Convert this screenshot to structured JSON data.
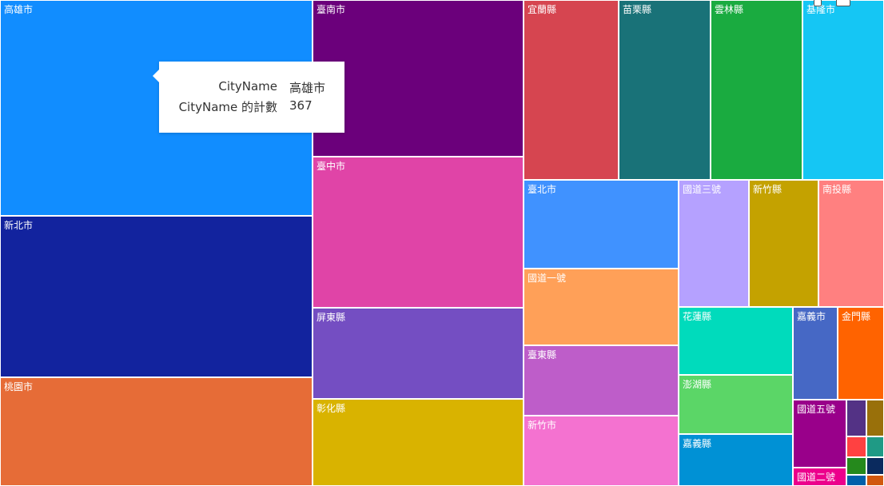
{
  "chart_data": {
    "type": "treemap",
    "series": [
      {
        "name": "高雄市",
        "color": "#118DFF"
      },
      {
        "name": "新北市",
        "color": "#12239E"
      },
      {
        "name": "桃園市",
        "color": "#E66C37"
      },
      {
        "name": "臺南市",
        "color": "#6B007B"
      },
      {
        "name": "臺中市",
        "color": "#E044A7"
      },
      {
        "name": "屏東縣",
        "color": "#744EC2"
      },
      {
        "name": "彰化縣",
        "color": "#D9B300"
      },
      {
        "name": "宜蘭縣",
        "color": "#D64550"
      },
      {
        "name": "苗栗縣",
        "color": "#197278"
      },
      {
        "name": "雲林縣",
        "color": "#1AAB40"
      },
      {
        "name": "基隆市",
        "color": "#15C6F4"
      },
      {
        "name": "臺北市",
        "color": "#4092FF"
      },
      {
        "name": "國道三號",
        "color": "#B5A1FF"
      },
      {
        "name": "新竹縣",
        "color": "#C4A200"
      },
      {
        "name": "南投縣",
        "color": "#FF8080"
      },
      {
        "name": "國道一號",
        "color": "#FFA058"
      },
      {
        "name": "臺東縣",
        "color": "#BE5DC9"
      },
      {
        "name": "新竹市",
        "color": "#F472D0"
      },
      {
        "name": "花蓮縣",
        "color": "#00DBBC"
      },
      {
        "name": "澎湖縣",
        "color": "#5BD667"
      },
      {
        "name": "嘉義縣",
        "color": "#0091D5"
      },
      {
        "name": "嘉義市",
        "color": "#4668C5"
      },
      {
        "name": "金門縣",
        "color": "#FF6300"
      },
      {
        "name": "國道五號",
        "color": "#99008A"
      },
      {
        "name": "國道二號",
        "color": "#EC008C"
      },
      {
        "name": "",
        "color": "#533285"
      },
      {
        "name": "",
        "color": "#99700A"
      },
      {
        "name": "",
        "color": "#FF4141"
      },
      {
        "name": "",
        "color": "#1F9A85"
      },
      {
        "name": "",
        "color": "#25891C"
      },
      {
        "name": "",
        "color": "#0A2A5E"
      },
      {
        "name": "",
        "color": "#0060AA"
      },
      {
        "name": "",
        "color": "#D1580E"
      }
    ],
    "tooltip": {
      "rows": [
        {
          "key": "CityName",
          "value": "高雄市"
        },
        {
          "key": "CityName 的計數",
          "value": "367"
        }
      ]
    }
  }
}
